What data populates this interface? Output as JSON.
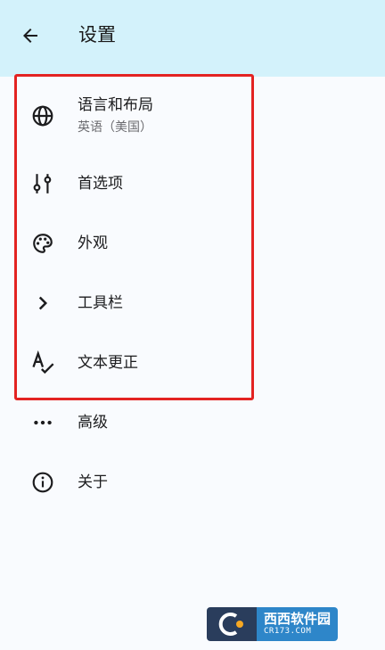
{
  "header": {
    "title": "设置",
    "back_icon": "arrow-back-icon",
    "background_color": "#d3f2fb"
  },
  "settings": [
    {
      "key": "language",
      "label": "语言和布局",
      "sublabel": "英语（美国）",
      "icon": "globe-icon"
    },
    {
      "key": "preferences",
      "label": "首选项",
      "icon": "sliders-icon"
    },
    {
      "key": "appearance",
      "label": "外观",
      "icon": "palette-icon"
    },
    {
      "key": "toolbar",
      "label": "工具栏",
      "icon": "chevron-right-icon"
    },
    {
      "key": "text-correction",
      "label": "文本更正",
      "icon": "spellcheck-icon"
    },
    {
      "key": "advanced",
      "label": "高级",
      "icon": "more-horizontal-icon"
    },
    {
      "key": "about",
      "label": "关于",
      "icon": "info-icon"
    }
  ],
  "highlight": {
    "color": "#e32322"
  },
  "watermark": {
    "main_text": "西西软件园",
    "sub_text": "CR173.COM"
  }
}
